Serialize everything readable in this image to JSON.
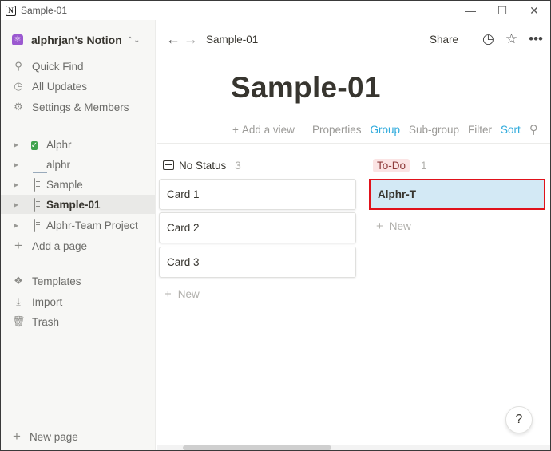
{
  "window": {
    "title": "Sample-01",
    "minimize": "—",
    "maximize": "☐",
    "close": "✕"
  },
  "sidebar": {
    "workspace": "alphrjan's Notion",
    "nav": [
      {
        "label": "Quick Find",
        "icon": "search-icon"
      },
      {
        "label": "All Updates",
        "icon": "clock-icon"
      },
      {
        "label": "Settings & Members",
        "icon": "gear-icon"
      }
    ],
    "pages": [
      {
        "label": "Alphr",
        "icon": "check-icon"
      },
      {
        "label": "alphr",
        "icon": "laptop-icon"
      },
      {
        "label": "Sample",
        "icon": "page-icon"
      },
      {
        "label": "Sample-01",
        "icon": "page-icon",
        "active": true
      },
      {
        "label": "Alphr-Team Project",
        "icon": "page-icon"
      }
    ],
    "add_page": "Add a page",
    "tools": [
      {
        "label": "Templates",
        "icon": "templates-icon"
      },
      {
        "label": "Import",
        "icon": "download-icon"
      },
      {
        "label": "Trash",
        "icon": "trash-icon"
      }
    ],
    "new_page": "New page"
  },
  "topbar": {
    "breadcrumb": "Sample-01",
    "share": "Share"
  },
  "page": {
    "title": "Sample-01"
  },
  "viewbar": {
    "add_view": "Add a view",
    "properties": "Properties",
    "group": "Group",
    "subgroup": "Sub-group",
    "filter": "Filter",
    "sort": "Sort"
  },
  "board": {
    "columns": [
      {
        "title": "No Status",
        "count": "3",
        "cards": [
          "Card 1",
          "Card 2",
          "Card 3"
        ],
        "new_label": "New"
      },
      {
        "title": "To-Do",
        "count": "1",
        "cards": [
          "Alphr-T"
        ],
        "new_label": "New"
      }
    ]
  },
  "help": "?",
  "colors": {
    "accent": "#2eaadc",
    "highlight_border": "#e0121b",
    "todo_pill": "#fbe4e4"
  }
}
